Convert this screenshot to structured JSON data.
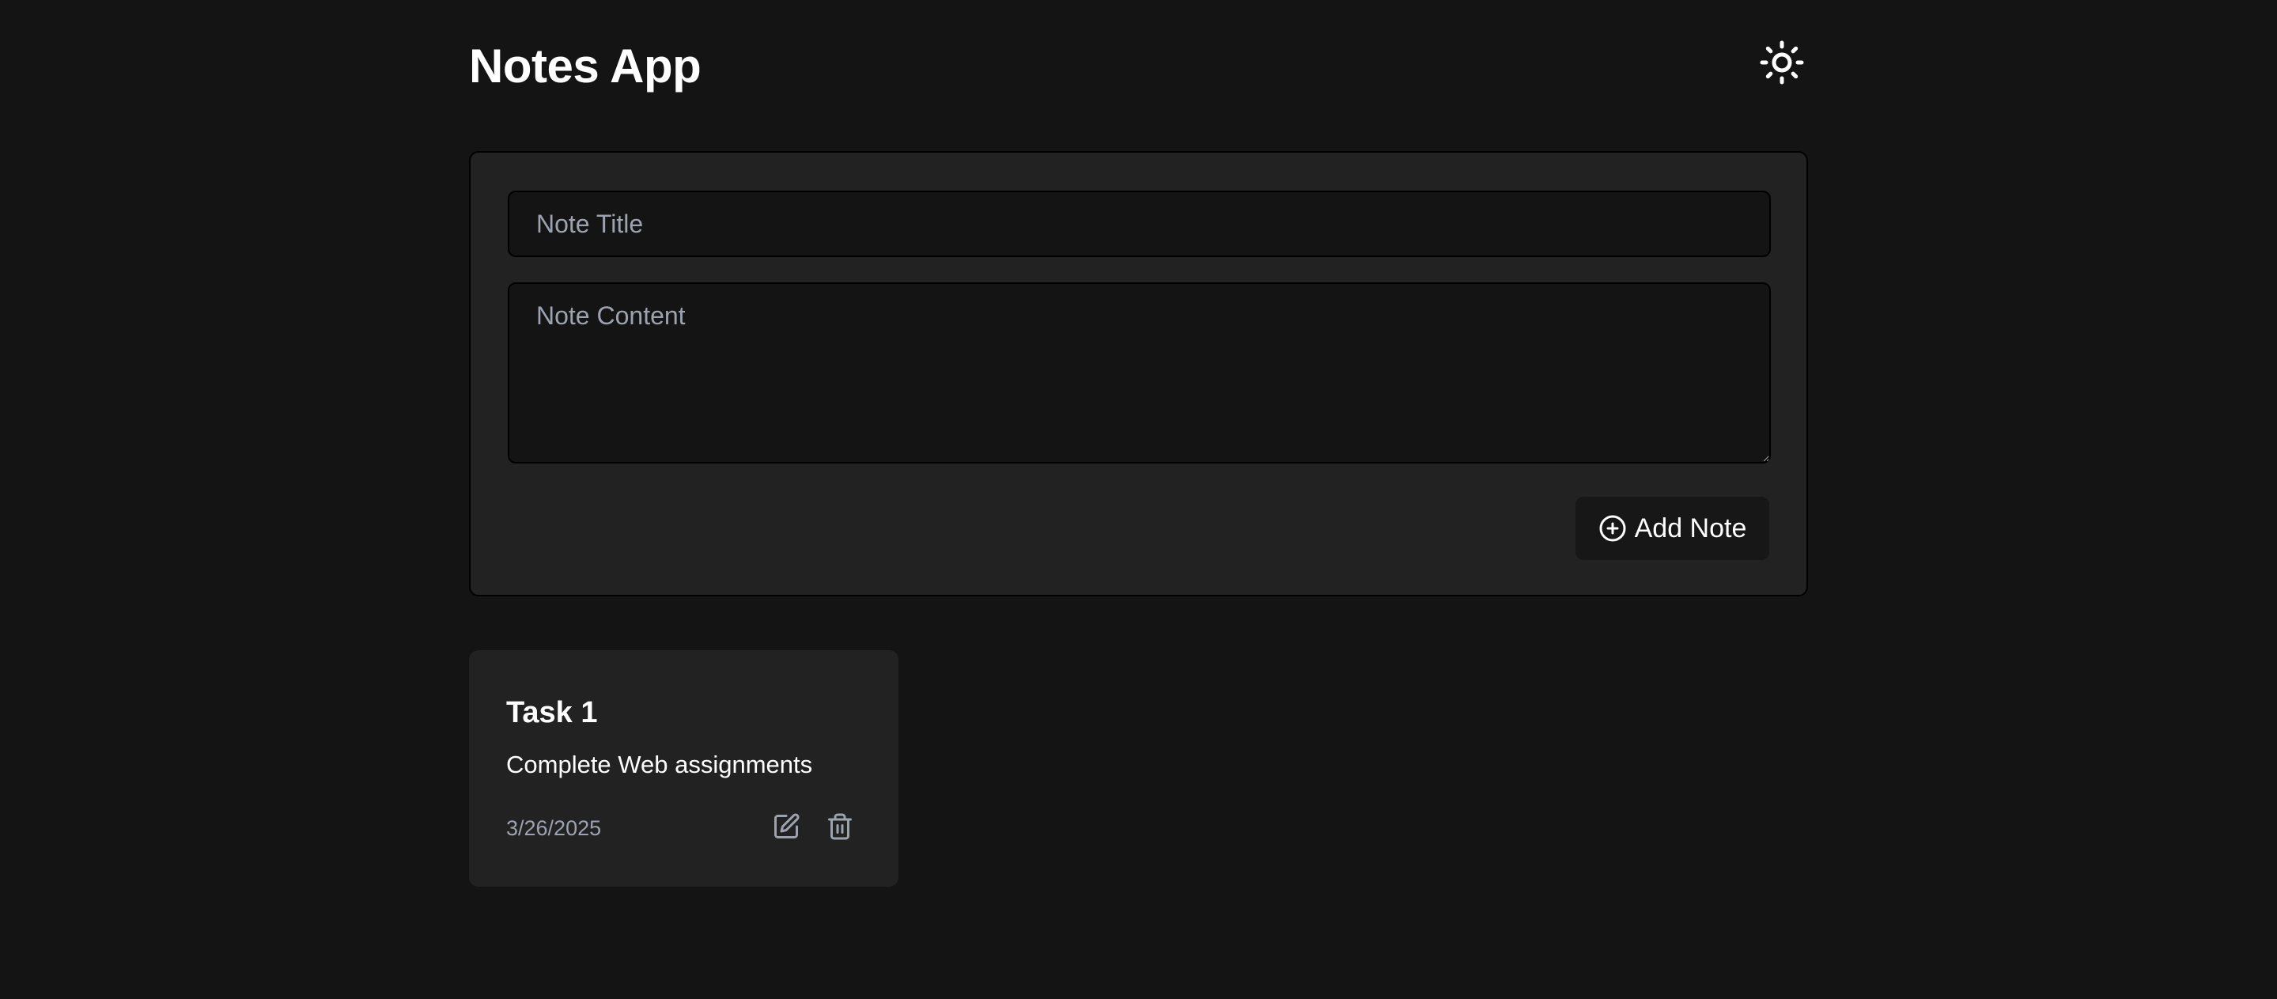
{
  "app": {
    "title": "Notes App"
  },
  "header": {
    "theme_toggle_icon": "sun-icon"
  },
  "form": {
    "title_placeholder": "Note Title",
    "title_value": "",
    "content_placeholder": "Note Content",
    "content_value": "",
    "add_button_label": "Add Note",
    "add_button_icon": "plus-circle-icon"
  },
  "notes": [
    {
      "title": "Task 1",
      "content": "Complete Web assignments",
      "date": "3/26/2025",
      "edit_icon": "edit-icon",
      "delete_icon": "trash-icon"
    }
  ],
  "colors": {
    "background": "#141414",
    "card": "#222222",
    "input": "#141414",
    "text": "#ffffff",
    "muted": "#9ca3af"
  }
}
